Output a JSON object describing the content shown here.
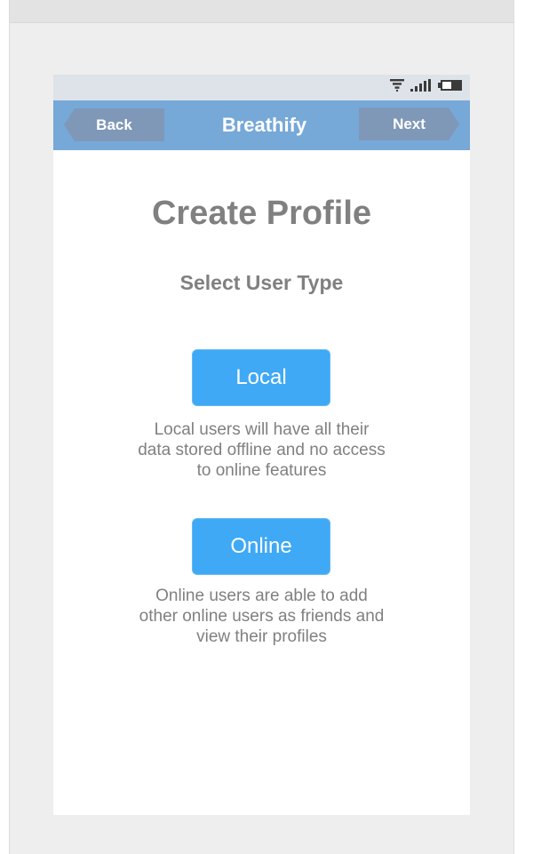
{
  "app": {
    "title": "Breathify"
  },
  "status_bar": {
    "icons": [
      "wifi-icon",
      "signal-icon",
      "battery-icon"
    ]
  },
  "nav": {
    "back_label": "Back",
    "next_label": "Next",
    "title": "Breathify"
  },
  "main": {
    "title": "Create Profile",
    "subtitle": "Select User Type",
    "options": [
      {
        "label": "Local",
        "description": "Local users will have all their data stored offline and no access to online features"
      },
      {
        "label": "Online",
        "description": "Online users are able to add other online users as friends and view their profiles"
      }
    ]
  },
  "colors": {
    "navbar": "#76a8d8",
    "nav_button": "#7f98b8",
    "status_bar": "#dde3e8",
    "primary_button": "#3fa9f5",
    "text_gray": "#808080"
  }
}
